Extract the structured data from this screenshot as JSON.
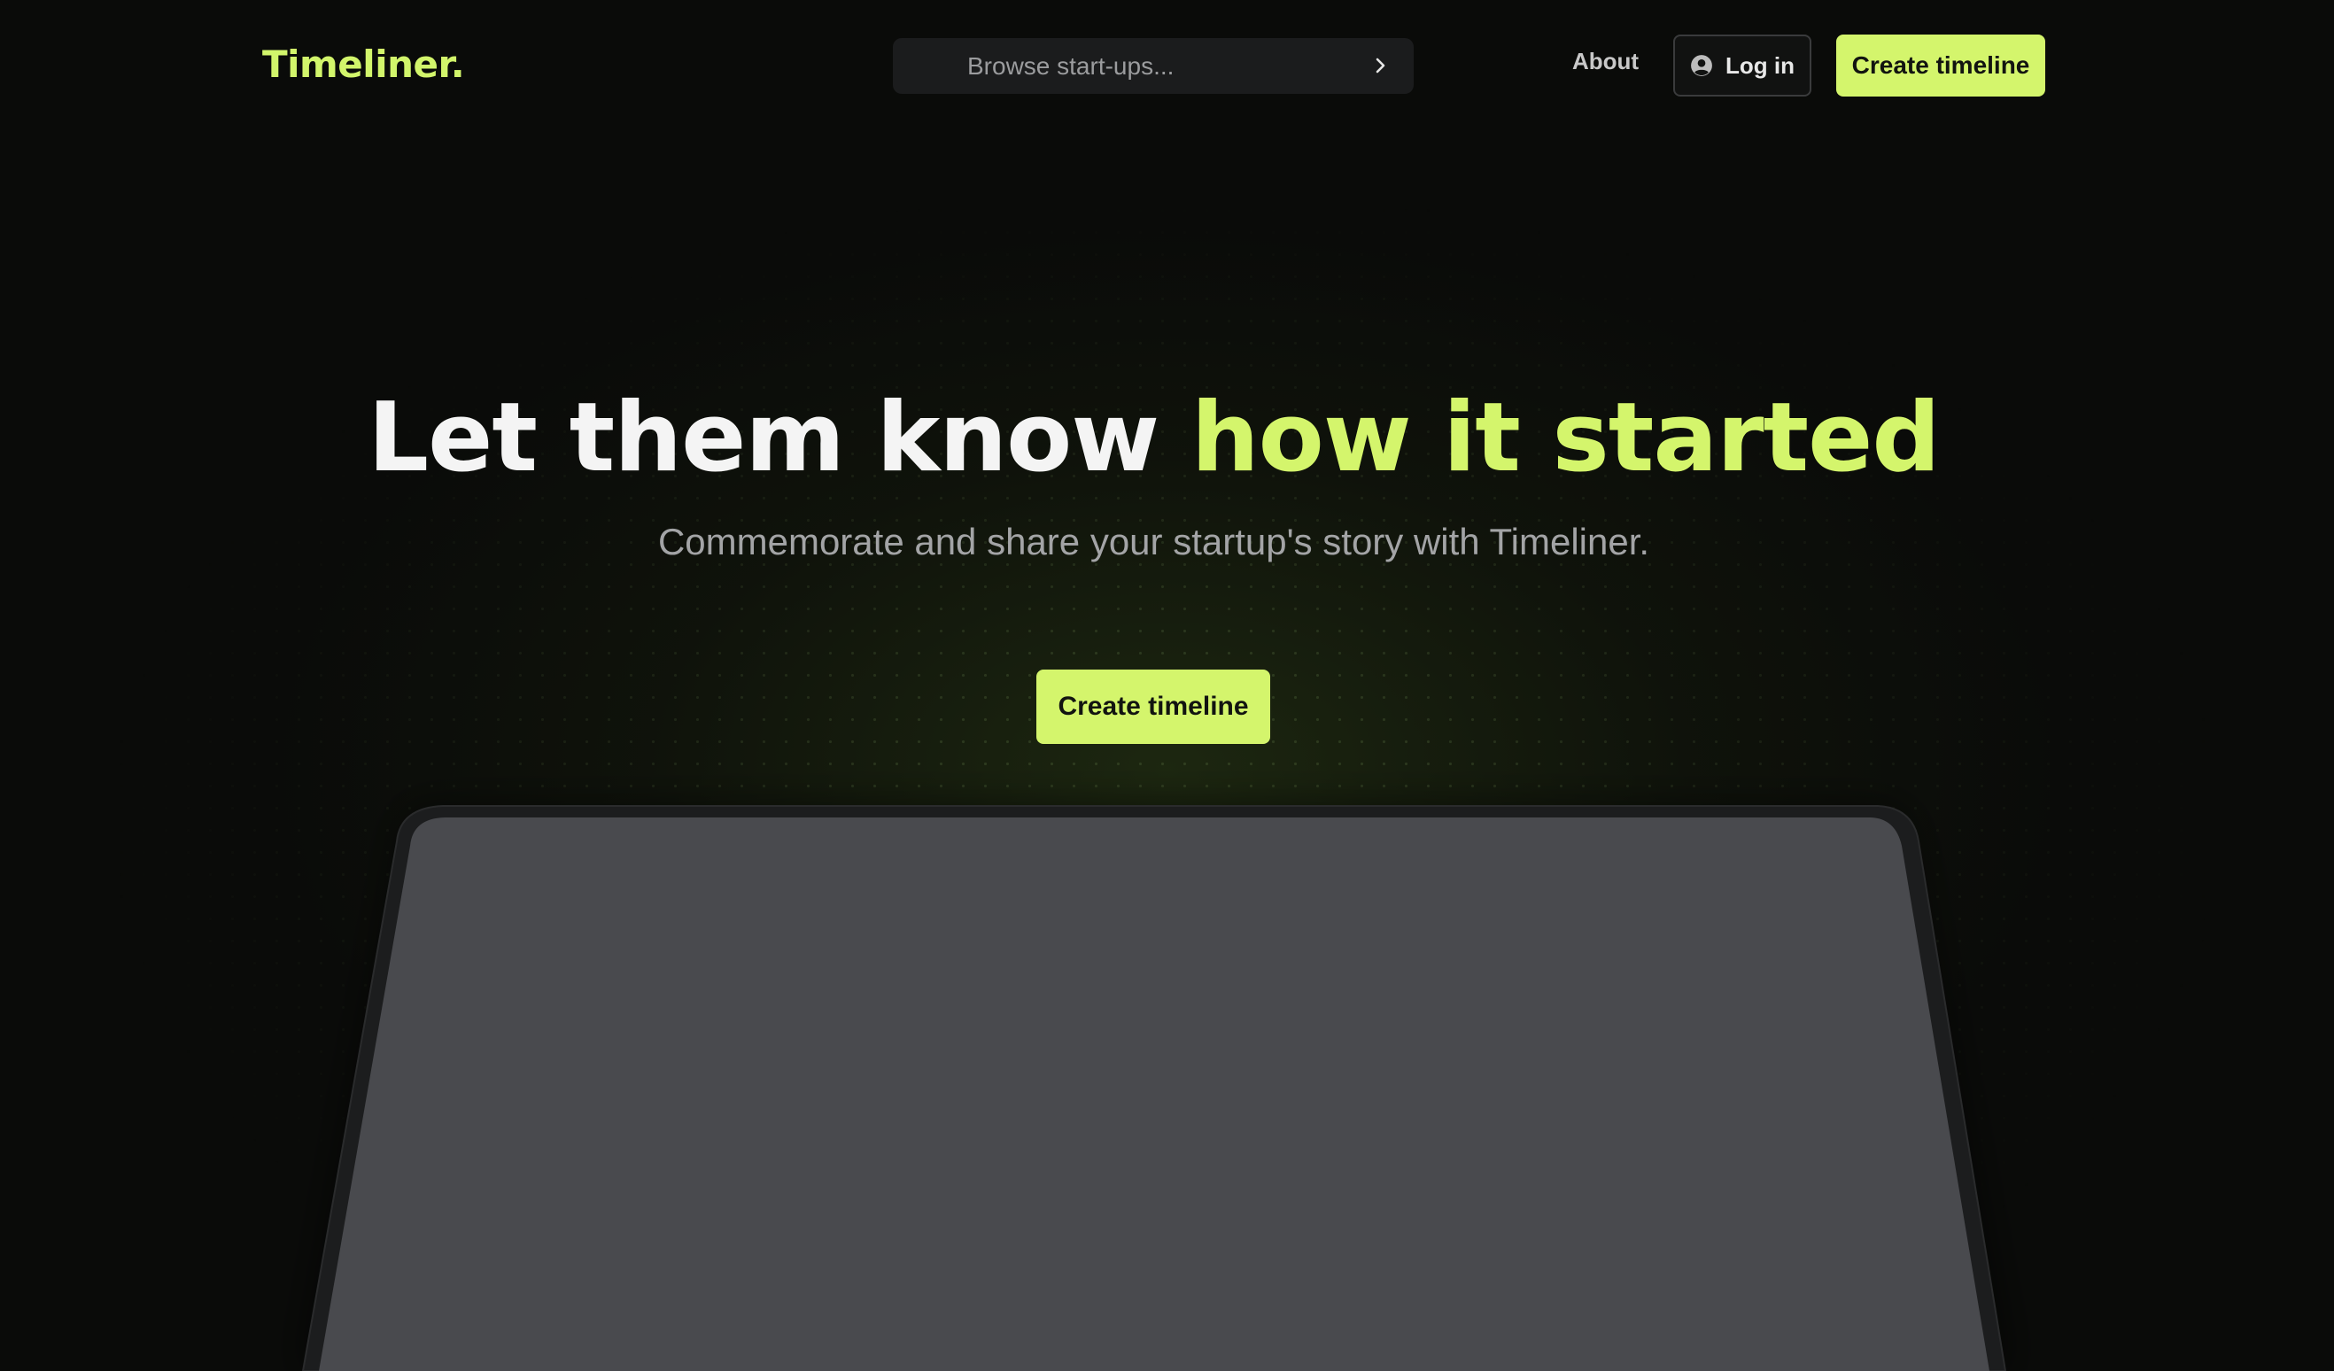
{
  "header": {
    "brand": "Timeliner.",
    "search": {
      "placeholder": "Browse start-ups..."
    },
    "nav": {
      "about": "About",
      "login": "Log in",
      "create": "Create timeline"
    }
  },
  "hero": {
    "headline_main": "Let them know ",
    "headline_accent": "how it started",
    "subhead": "Commemorate and share your startup's story with Timeliner.",
    "cta": "Create timeline"
  },
  "colors": {
    "accent": "#d4f56c",
    "background": "#0a0b09",
    "screen": "#494a4e",
    "bezel": "#1c1d1e"
  },
  "icons": {
    "search_arrow": "chevron-right-icon",
    "login": "user-circle-icon"
  }
}
